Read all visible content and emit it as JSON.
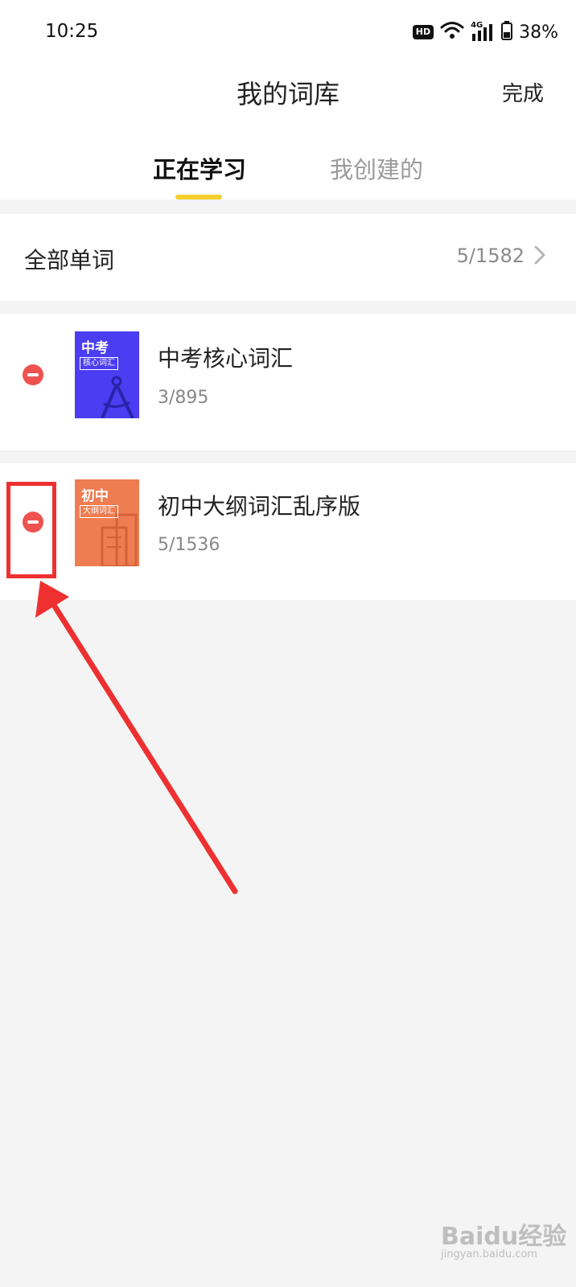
{
  "status_bar": {
    "time": "10:25",
    "hd_badge": "HD",
    "network": "4G",
    "battery": "38%",
    "icons": [
      "hd-icon",
      "wifi-icon",
      "signal-icon",
      "battery-icon"
    ]
  },
  "header": {
    "title": "我的词库",
    "done_label": "完成"
  },
  "tabs": [
    {
      "label": "正在学习",
      "active": true
    },
    {
      "label": "我创建的",
      "active": false
    }
  ],
  "all_words": {
    "label": "全部单词",
    "count": "5/1582"
  },
  "books": [
    {
      "name": "中考核心词汇",
      "progress": "3/895",
      "cover_big": "中考",
      "cover_small": "核心词汇",
      "cover_color": "#4a3df2"
    },
    {
      "name": "初中大纲词汇乱序版",
      "progress": "5/1536",
      "cover_big": "初中",
      "cover_small": "大纲词汇",
      "cover_color": "#ee7d52"
    }
  ],
  "colors": {
    "accent": "#f5cf2e",
    "remove": "#ee5250",
    "annotation": "#ee3030"
  },
  "watermark": {
    "brand": "Baidu经验",
    "url": "jingyan.baidu.com"
  }
}
